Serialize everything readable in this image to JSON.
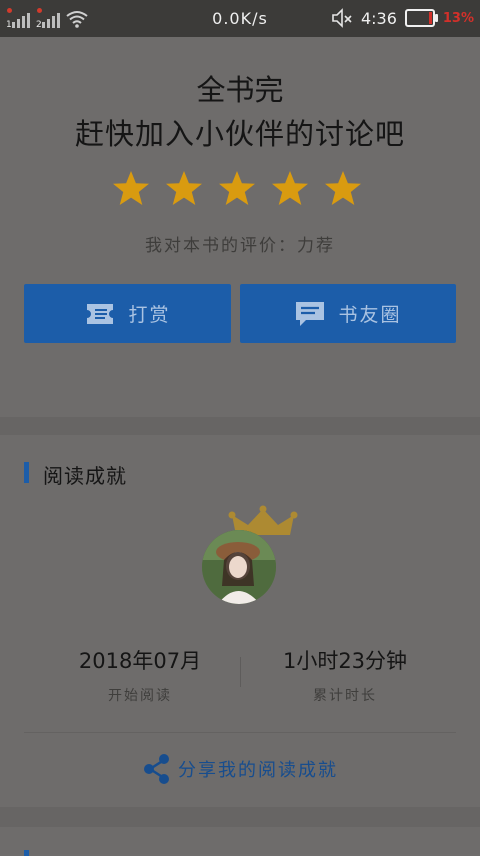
{
  "status_bar": {
    "sim1": "1",
    "sim2": "2",
    "speed": "0.0K/s",
    "time": "4:36",
    "battery_pct": "13%",
    "battery_level": 0.13,
    "icons": [
      "signal-icon",
      "wifi-icon",
      "mute-icon",
      "battery-icon"
    ]
  },
  "book": {
    "status": "全书完",
    "invite": "赶快加入小伙伴的讨论吧",
    "stars": 5,
    "rating_text": "我对本书的评价：力荐",
    "star_color": "#d99b10"
  },
  "actions": {
    "reward_label": "打赏",
    "circle_label": "书友圈",
    "button_color": "#1c5da9"
  },
  "achievement": {
    "title": "阅读成就",
    "start_value": "2018年07月",
    "start_label": "开始阅读",
    "duration_value": "1小时23分钟",
    "duration_label": "累计时长",
    "share_label": "分享我的阅读成就"
  }
}
